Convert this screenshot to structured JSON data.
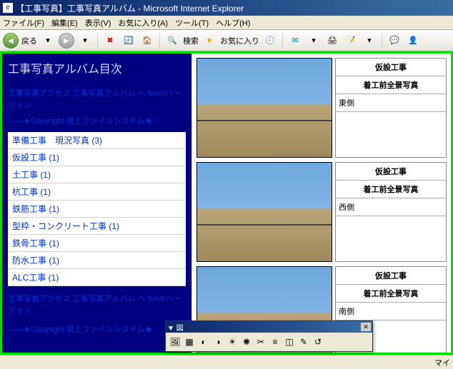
{
  "window": {
    "title": "【工事写真】工事写真アルバム - Microsoft Internet Explorer"
  },
  "menu": {
    "file": "ファイル(F)",
    "edit": "編集(E)",
    "view": "表示(V)",
    "favorites": "お気に入り(A)",
    "tools": "ツール(T)",
    "help": "ヘルプ(H)"
  },
  "toolbar": {
    "back": "戻る",
    "search": "検索",
    "favorites": "お気に入り"
  },
  "sidebar": {
    "title": "工事写真アルバム目次",
    "notice1": "工事写真アクセス 工事写真アルバム へ New!バージョン",
    "notice2": "――★Copyright 県土ファイルシステム★",
    "categories": [
      "準備工事　現況写真 (3)",
      "仮設工事 (1)",
      "土工事 (1)",
      "杭工事 (1)",
      "鉄筋工事 (1)",
      "型枠・コンクリート工事 (1)",
      "鉄骨工事 (1)",
      "防水工事 (1)",
      "ALC工事 (1)"
    ],
    "footer1": "工事写真アクセス 工事写真アルバム へ New!バージョン",
    "footer2": "――★Copyright 県土ファイルシステム★"
  },
  "photos": [
    {
      "category": "仮設工事",
      "subcategory": "着工前全景写真",
      "label": "東側"
    },
    {
      "category": "仮設工事",
      "subcategory": "着工前全景写真",
      "label": "西側"
    },
    {
      "category": "仮設工事",
      "subcategory": "着工前全景写真",
      "label": "南側"
    }
  ],
  "floatingToolbar": {
    "title": "▼ 図"
  },
  "statusbar": {
    "zone": "マイ"
  }
}
